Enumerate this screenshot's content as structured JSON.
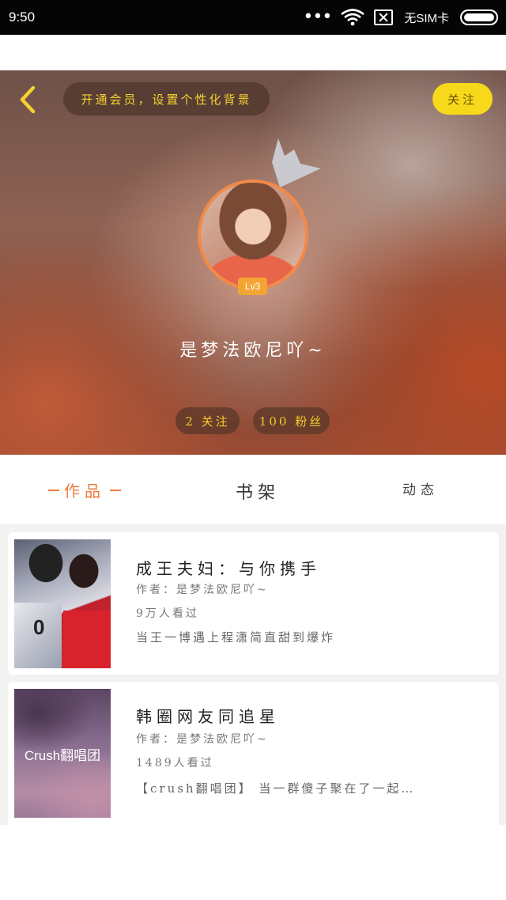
{
  "status_bar": {
    "time": "9:50",
    "dots": "•••",
    "sim": "无SIM卡",
    "icons": [
      "wifi-icon",
      "sim-error-icon",
      "battery-icon"
    ]
  },
  "header": {
    "vip_prompt": "开通会员，设置个性化背景",
    "follow_label": "关注",
    "back_icon": "chevron-left-icon"
  },
  "profile": {
    "level": "Lv3",
    "nickname": "是梦法欧尼吖~",
    "following": "2 关注",
    "fans": "100 粉丝"
  },
  "tabs": [
    {
      "label": "作品",
      "active": true
    },
    {
      "label": "书架",
      "active": false
    },
    {
      "label": "动态",
      "active": false
    }
  ],
  "works": [
    {
      "title": "成王夫妇：与你携手",
      "author": "作者：是梦法欧尼吖~",
      "views": "9万人看过",
      "desc": "当王一博遇上程潇简直甜到爆炸",
      "cover_text": "0"
    },
    {
      "title": "韩圈网友同追星",
      "author": "作者：是梦法欧尼吖~",
      "views": "1489人看过",
      "desc": "【crush翻唱团】 当一群傻子聚在了一起…",
      "cover_text": "Crush翻唱团"
    }
  ],
  "colors": {
    "accent_orange": "#f07a3a",
    "accent_yellow": "#f7d81a",
    "badge_orange": "#f3a534"
  }
}
